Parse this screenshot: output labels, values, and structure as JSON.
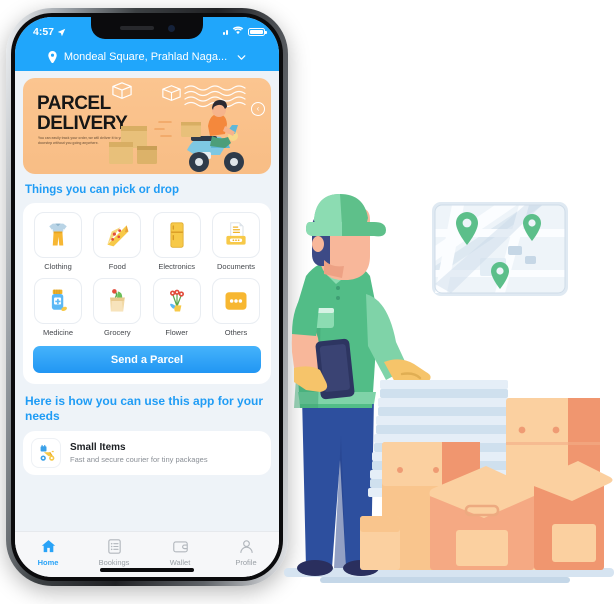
{
  "status_bar": {
    "time": "4:57",
    "location_icon": "location-arrow-icon",
    "signal_icon": "signal-dots-icon",
    "wifi_icon": "wifi-icon",
    "battery_icon": "battery-full-icon"
  },
  "location_bar": {
    "pin_icon": "map-pin-icon",
    "address": "Mondeal Square, Prahlad Naga...",
    "chevron_icon": "chevron-down-icon"
  },
  "banner": {
    "title_line1": "PARCEL",
    "title_line2": "DELIVERY",
    "subtext": "You can easily track your order, we will deliver it to your doorstep without you going anywhere.",
    "nav_button_icon": "chevron-left-icon",
    "bg_color": "#f9bf88",
    "illustration": "scooter-delivery-illustration"
  },
  "sections": {
    "categories_title": "Things you can pick or  drop",
    "howto_title": "Here is how you can use this app for your needs"
  },
  "categories": [
    {
      "label": "Clothing",
      "icon": "clothing-icon"
    },
    {
      "label": "Food",
      "icon": "pizza-icon"
    },
    {
      "label": "Electronics",
      "icon": "refrigerator-icon"
    },
    {
      "label": "Documents",
      "icon": "documents-icon"
    },
    {
      "label": "Medicine",
      "icon": "medicine-bottle-icon"
    },
    {
      "label": "Grocery",
      "icon": "grocery-bag-icon"
    },
    {
      "label": "Flower",
      "icon": "flower-bouquet-icon"
    },
    {
      "label": "Others",
      "icon": "ellipsis-icon"
    }
  ],
  "send_button": {
    "label": "Send a Parcel",
    "color": "#2196f3"
  },
  "howto_items": [
    {
      "icon": "scooter-icon",
      "title": "Small Items",
      "subtitle": "Fast and secure courier for tiny packages"
    }
  ],
  "bottom_nav": {
    "active": "Home",
    "items": [
      {
        "label": "Home",
        "icon": "home-icon",
        "active": true
      },
      {
        "label": "Bookings",
        "icon": "list-icon",
        "active": false
      },
      {
        "label": "Wallet",
        "icon": "wallet-icon",
        "active": false
      },
      {
        "label": "Profile",
        "icon": "person-icon",
        "active": false
      }
    ]
  },
  "illustration": {
    "name": "delivery-courier-with-parcels-illustration",
    "map_card": {
      "name": "map-card",
      "pins": 3,
      "pin_color": "#5cbf8a"
    },
    "courier": {
      "cap_color": "#5ec08a",
      "shirt_color": "#52bd87",
      "trousers_color": "#2d4f9e",
      "glove_color": "#f6c46a",
      "phone_icon": "smartphone-icon"
    },
    "paper_stack_color": "#cfe0ee",
    "boxes_color": "#f9c58d",
    "accent_color": "#f0966f"
  },
  "theme": {
    "primary": "#20a6fb",
    "page_bg": "#eef3f8",
    "card_bg": "#ffffff",
    "text_dark": "#1c1f23",
    "text_muted": "#8a8f96"
  }
}
